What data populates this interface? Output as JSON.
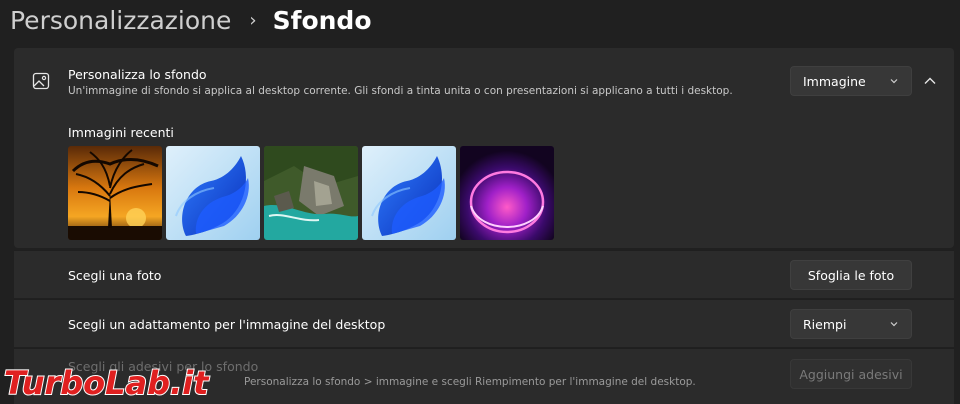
{
  "breadcrumb": {
    "parent": "Personalizzazione",
    "separator": "›",
    "current": "Sfondo"
  },
  "background_panel": {
    "title": "Personalizza lo sfondo",
    "description": "Un'immagine di sfondo si applica al desktop corrente. Gli sfondi a tinta unita o con presentazioni si applicano a tutti i desktop.",
    "type_dropdown": {
      "value": "Immagine"
    },
    "icon": "image-icon",
    "collapse_icon": "chevron-up-icon",
    "recent_label": "Immagini recenti",
    "recent_images": [
      {
        "name": "sunset-tree-thumbnail"
      },
      {
        "name": "windows-bloom-blue-thumbnail"
      },
      {
        "name": "coastal-rocks-thumbnail"
      },
      {
        "name": "windows-bloom-blue-thumbnail-2"
      },
      {
        "name": "purple-glow-thumbnail"
      }
    ]
  },
  "rows": {
    "choose_photo": {
      "label": "Scegli una foto",
      "button": "Sfoglia le foto"
    },
    "fit": {
      "label": "Scegli un adattamento per l'immagine del desktop",
      "dropdown_value": "Riempi"
    },
    "stickers": {
      "label": "Scegli gli adesivi per lo sfondo",
      "sub": "Personalizza lo sfondo > immagine e scegli Riempimento per l'immagine del desktop.",
      "button": "Aggiungi adesivi"
    }
  },
  "watermark": {
    "text": "TurboLab.it"
  },
  "colors": {
    "background": "#202020",
    "card": "#2b2b2b",
    "control": "#373737",
    "watermark_red": "#e02020"
  }
}
